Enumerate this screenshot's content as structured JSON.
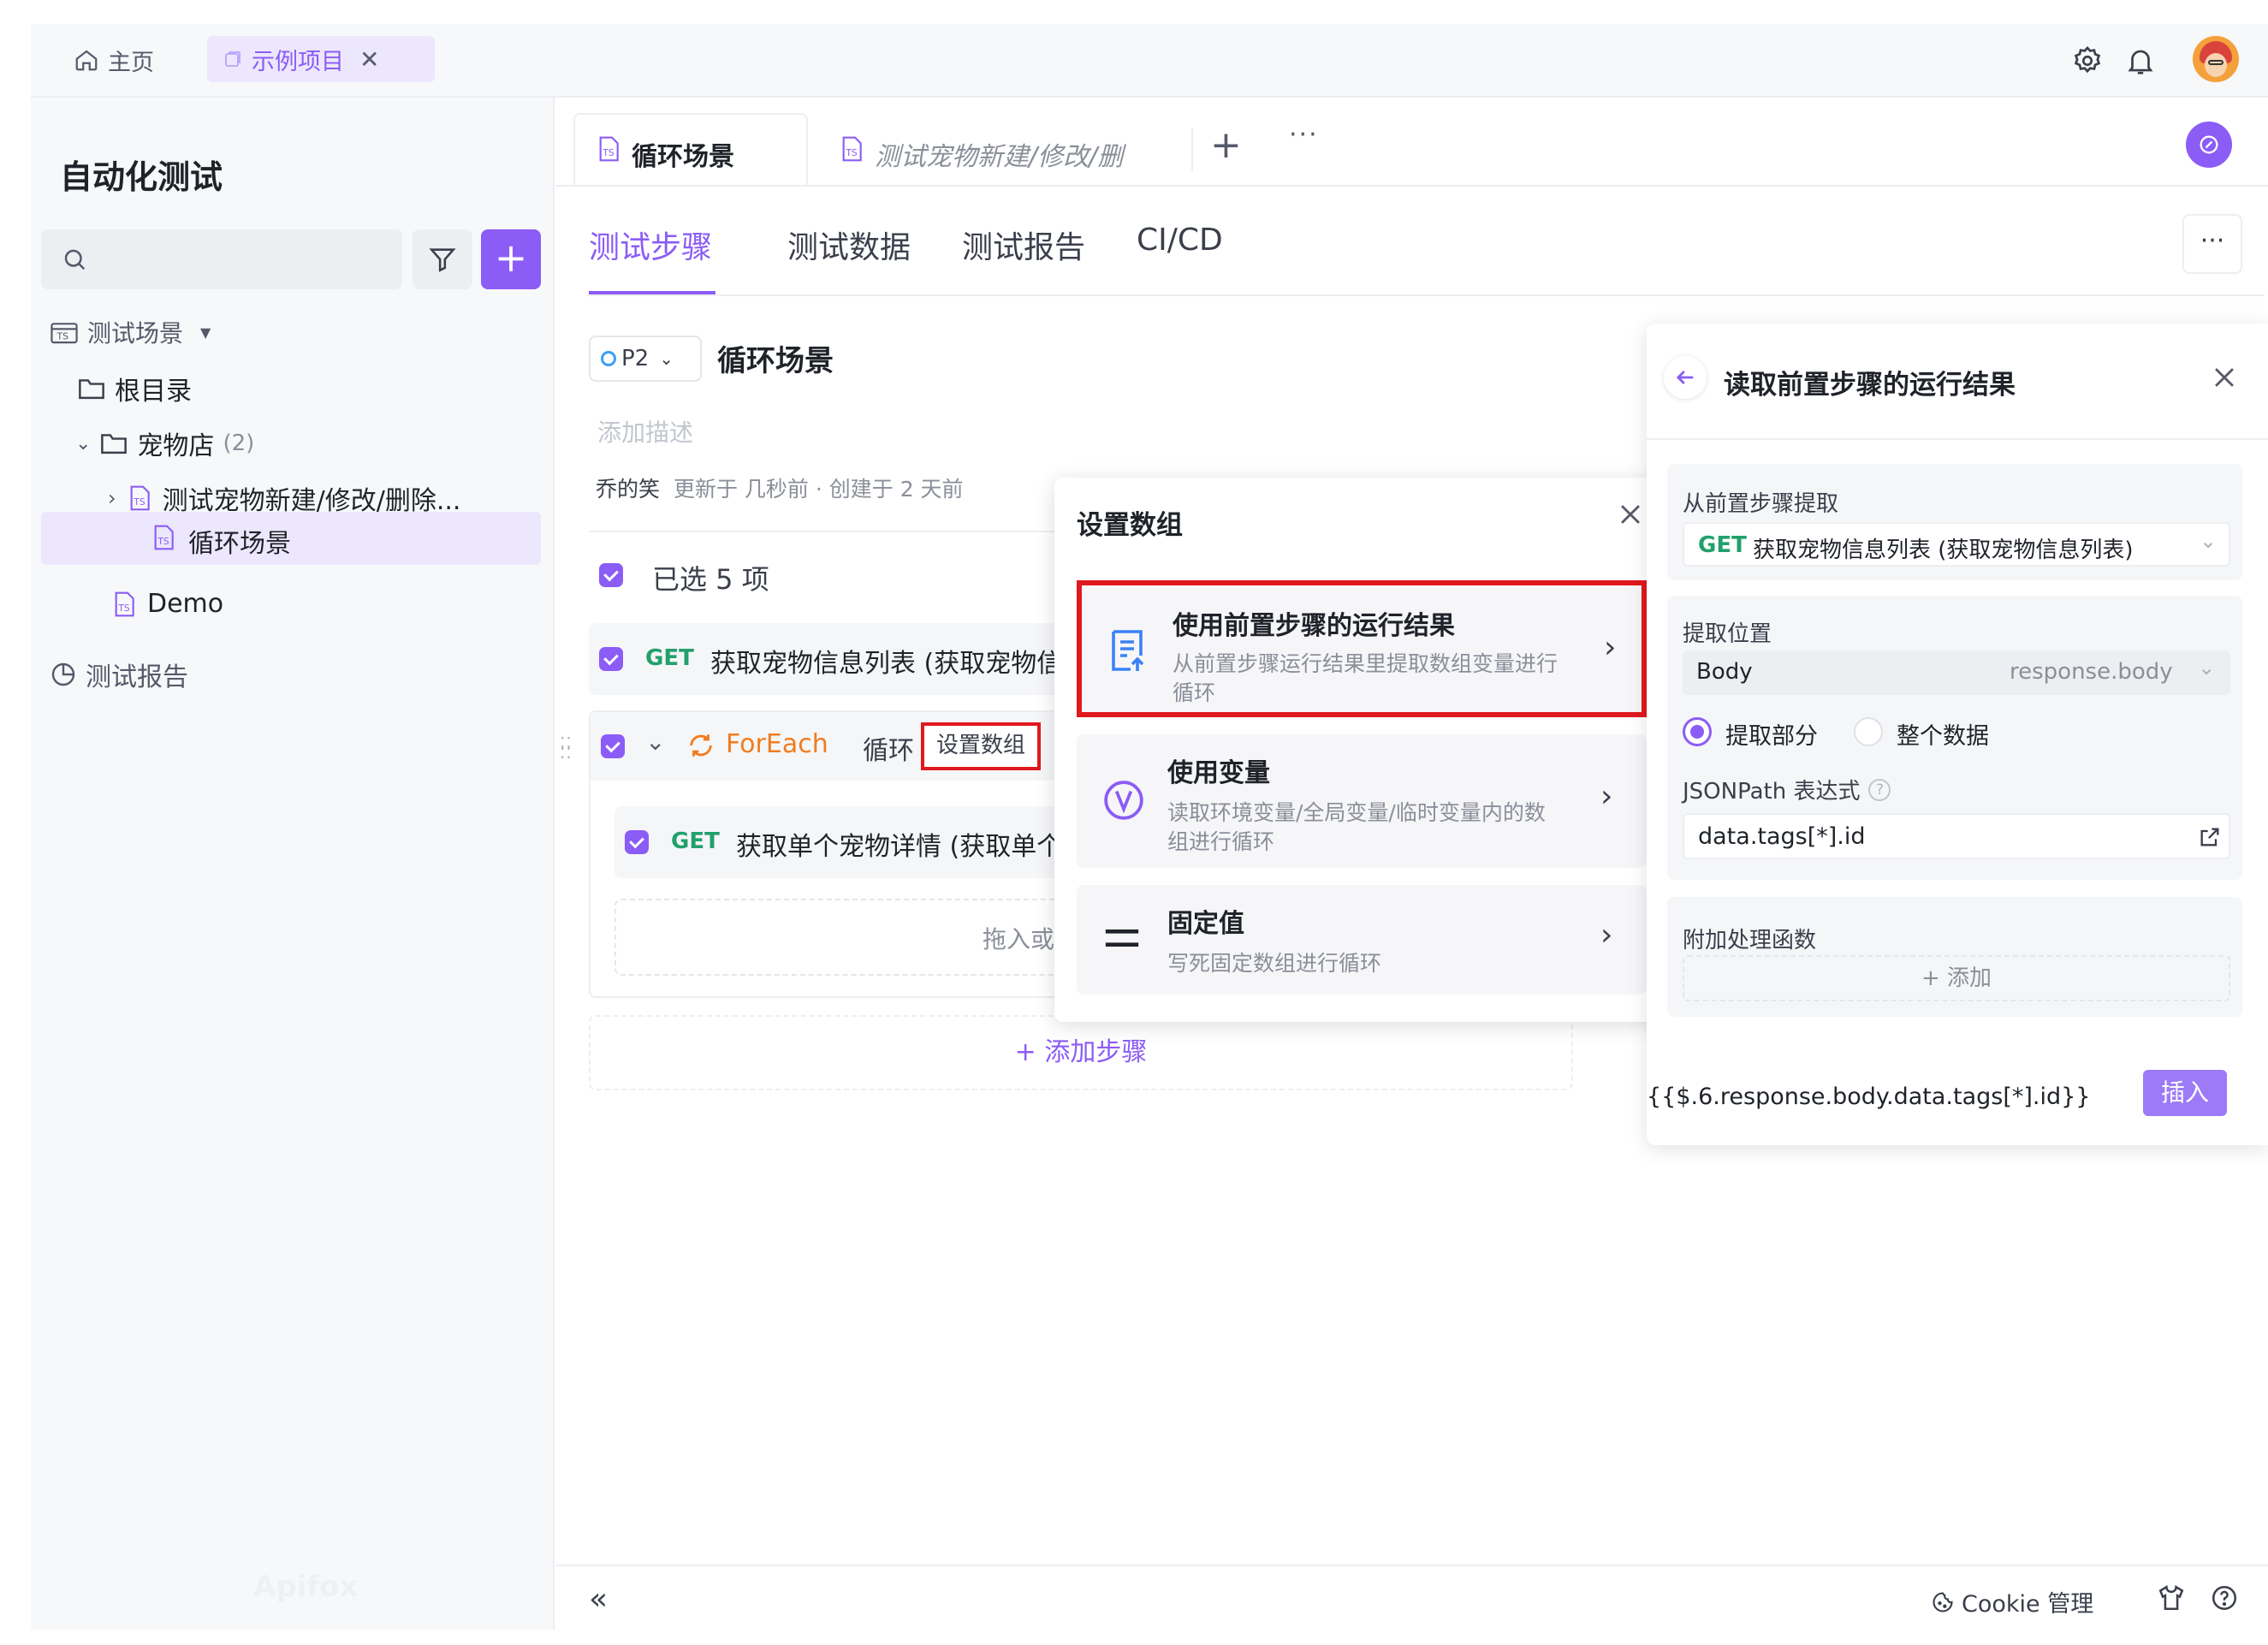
{
  "topbar": {
    "home_label": "主页",
    "project_tab": "示例项目"
  },
  "sidebar": {
    "title": "自动化测试",
    "search_placeholder": "",
    "scenarios_label": "测试场景",
    "root_label": "根目录",
    "folder_label": "宠物店",
    "folder_count": "(2)",
    "item1_label": "测试宠物新建/修改/删除...",
    "item2_label": "循环场景",
    "demo_label": "Demo",
    "reports_label": "测试报告",
    "watermark": "Apifox"
  },
  "tabs": {
    "active": "循环场景",
    "inactive": "测试宠物新建/修改/删"
  },
  "subtabs": [
    "测试步骤",
    "测试数据",
    "测试报告",
    "CI/CD"
  ],
  "scenario": {
    "priority": "P2",
    "title": "循环场景",
    "description_placeholder": "添加描述",
    "author": "乔的笑",
    "meta": "更新于 几秒前 · 创建于 2 天前",
    "selected_label": "已选 5 项",
    "step1_method": "GET",
    "step1_name": "获取宠物信息列表 (获取宠物信",
    "foreach_label": "ForEach",
    "loop_label": "循环",
    "set_array_label": "设置数组",
    "step2_method": "GET",
    "step2_name": "获取单个宠物详情 (获取单个",
    "drop_hint": "拖入或",
    "add_step_label": "+ 添加步骤"
  },
  "popup": {
    "title": "设置数组",
    "options": [
      {
        "title": "使用前置步骤的运行结果",
        "desc1": "从前置步骤运行结果里提取数组变量进行",
        "desc2": "循环"
      },
      {
        "title": "使用变量",
        "desc1": "读取环境变量/全局变量/临时变量内的数",
        "desc2": "组进行循环"
      },
      {
        "title": "固定值",
        "desc1": "写死固定数组进行循环",
        "desc2": ""
      }
    ]
  },
  "panel": {
    "title": "读取前置步骤的运行结果",
    "source_label": "从前置步骤提取",
    "source_method": "GET",
    "source_value": "获取宠物信息列表 (获取宠物信息列表)",
    "location_label": "提取位置",
    "location_value": "Body",
    "location_hint": "response.body",
    "radio_part": "提取部分",
    "radio_all": "整个数据",
    "jsonpath_label": "JSONPath 表达式",
    "jsonpath_value": "data.tags[*].id",
    "func_label": "附加处理函数",
    "func_add": "+ 添加",
    "expression": "{{$.6.response.body.data.tags[*].id}}",
    "insert_label": "插入"
  },
  "footer": {
    "cookie_label": "Cookie 管理"
  },
  "colors": {
    "accent": "#8b5cf6",
    "get": "#22a06b",
    "foreach": "#f07c1f",
    "highlight": "#e0191e"
  }
}
